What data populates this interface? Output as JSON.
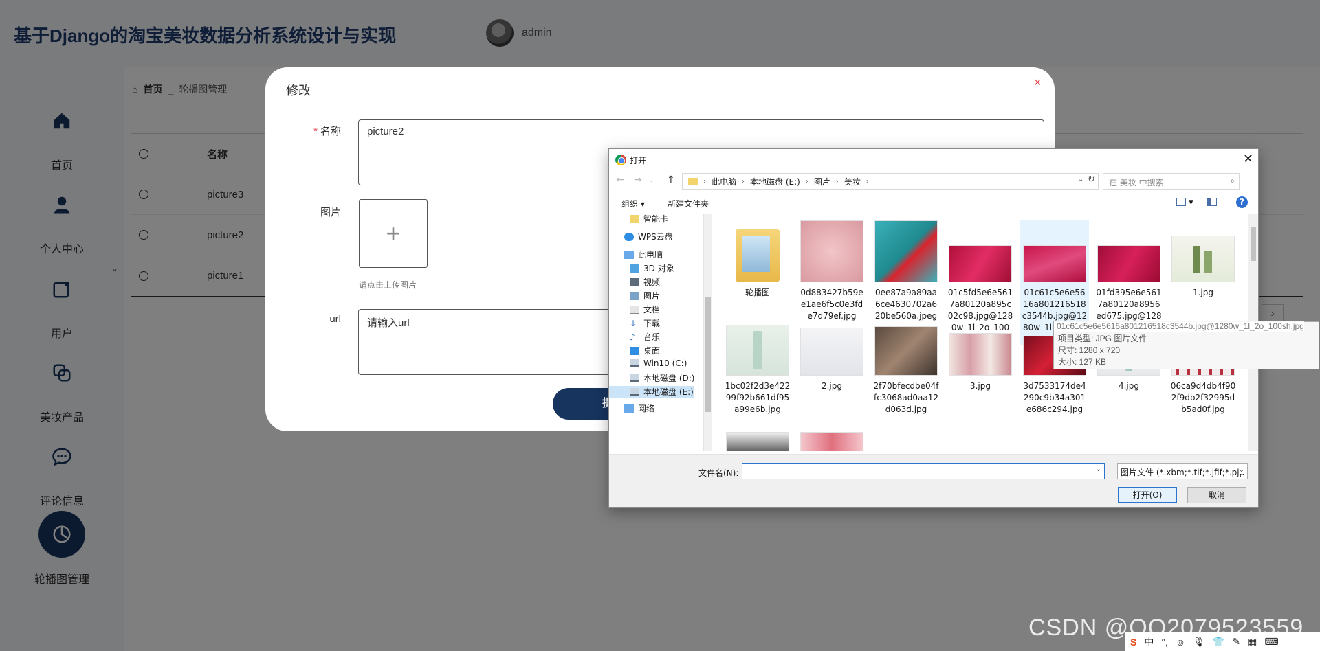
{
  "app": {
    "title": "基于Django的淘宝美妆数据分析系统设计与实现",
    "user": "admin"
  },
  "sidebar": {
    "items": [
      {
        "label": "首页",
        "icon": "home-icon"
      },
      {
        "label": "个人中心",
        "icon": "person-icon"
      },
      {
        "label": "用户",
        "icon": "user-card-icon"
      },
      {
        "label": "美妆产品",
        "icon": "product-icon"
      },
      {
        "label": "评论信息",
        "icon": "comment-icon"
      },
      {
        "label": "轮播图管理",
        "icon": "pie-chart-icon",
        "active": true
      }
    ]
  },
  "breadcrumb": {
    "home": "首页",
    "current": "轮播图管理"
  },
  "table": {
    "headers": [
      "名称"
    ],
    "rows": [
      "picture3",
      "picture2",
      "picture1"
    ]
  },
  "modal": {
    "title": "修改",
    "name_label": "名称",
    "name_value": "picture2",
    "image_label": "图片",
    "upload_hint": "请点击上传图片",
    "url_label": "url",
    "url_placeholder": "请输入url",
    "submit_partial": "提"
  },
  "dialog": {
    "title": "打开",
    "path": [
      "此电脑",
      "本地磁盘 (E:)",
      "图片",
      "美妆"
    ],
    "search_placeholder": "在 美妆 中搜索",
    "organize": "组织 ▾",
    "new_folder": "新建文件夹",
    "tree": [
      "智能卡",
      "WPS云盘",
      "此电脑",
      "3D 对象",
      "视频",
      "图片",
      "文档",
      "下载",
      "音乐",
      "桌面",
      "Win10 (C:)",
      "本地磁盘 (D:)",
      "本地磁盘 (E:)",
      "网络"
    ],
    "files": [
      "轮播图",
      "0d883427b59ee1ae6f5c0e3fde7d79ef.jpg",
      "0ee87a9a89aa6ce4630702a620be560a.jpeg",
      "01c5fd5e6e5617a80120a895c02c98.jpg@1280w_1l_2o_100s...",
      "01c61c5e6e5616a801216518c3544b.jpg@1280w_1l_2o_100s...",
      "01fd395e6e5617a80120a8956ed675.jpg@1280w_1l_2o_100s...",
      "1.jpg",
      "1bc02f2d3e42299f92b661df95a99e6b.jpg",
      "2.jpg",
      "2f70bfecdbe04ffc3068ad0aa12d063d.jpg",
      "3.jpg",
      "3d7533174de4290c9b34a301e686c294.jpg",
      "4.jpg",
      "06ca9d4db4f902f9db2f32995db5ad0f.jpg"
    ],
    "tooltip_filename": "01c61c5e6e5616a801216518c3544b.jpg@1280w_1l_2o_100sh.jpg",
    "tooltip_lines": [
      "项目类型: JPG 图片文件",
      "尺寸: 1280 x 720",
      "大小: 127 KB"
    ],
    "filename_label": "文件名(N):",
    "filter": "图片文件 (*.xbm;*.tif;*.jfif;*.pjp",
    "open": "打开(O)",
    "cancel": "取消"
  },
  "watermark": "CSDN @QQ2079523559",
  "tray": {
    "ime": "中"
  }
}
